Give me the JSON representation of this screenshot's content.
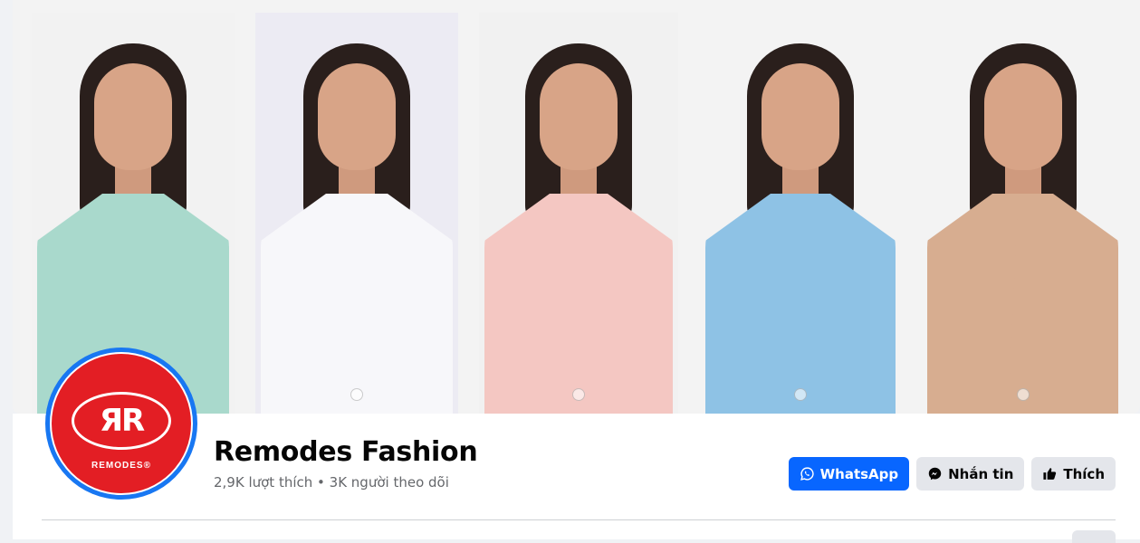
{
  "cover": {
    "models": [
      {
        "jacket": "#a9d9cc",
        "inner": "#ffffff",
        "panel_bg": "#f2f2f2"
      },
      {
        "jacket": "#f4f4f6",
        "inner": "#f0473e",
        "panel_bg": "#ecebf3"
      },
      {
        "jacket": "#f4c7c2",
        "inner": "#f2523e",
        "panel_bg": "#f1f1f1"
      },
      {
        "jacket": "#8ec2e5",
        "inner": "#ffffff",
        "panel_bg": "#f3f3f3"
      },
      {
        "jacket": "#d7ad90",
        "inner": "#f4c342",
        "panel_bg": "#f3f3f3"
      }
    ]
  },
  "profile": {
    "avatar_monogram": "ЯR",
    "avatar_brand": "REMODES®",
    "name": "Remodes Fashion",
    "stats": "2,9K lượt thích • 3K người theo dõi"
  },
  "actions": {
    "whatsapp_label": "WhatsApp",
    "message_label": "Nhắn tin",
    "like_label": "Thích"
  },
  "colors": {
    "brand_red": "#e31e24",
    "facebook_blue": "#0866ff",
    "avatar_ring": "#1877f2"
  },
  "icons": {
    "whatsapp": "whatsapp-icon",
    "messenger": "messenger-icon",
    "like": "thumbs-up-icon"
  }
}
